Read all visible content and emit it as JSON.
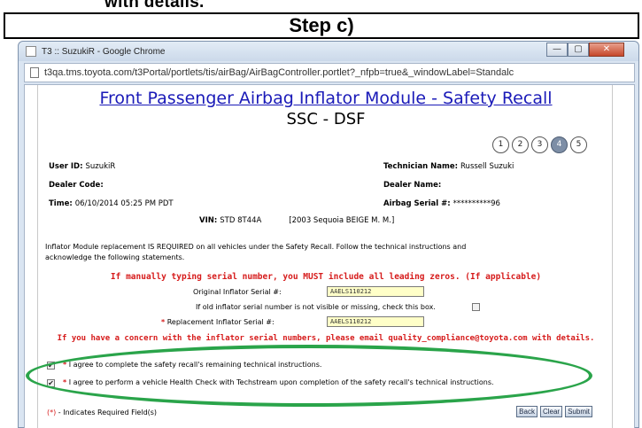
{
  "top_cut_text": "with details.",
  "step_heading": "Step c)",
  "window": {
    "title": "T3 :: SuzukiR - Google Chrome",
    "minimize": "—",
    "maximize": "▢",
    "close": "✕",
    "url": "t3qa.tms.toyota.com/t3Portal/portlets/tis/airBag/AirBagController.portlet?_nfpb=true&_windowLabel=Standalc"
  },
  "page": {
    "title": "Front Passenger Airbag Inflator Module - Safety Recall",
    "subtitle": "SSC - DSF",
    "steps": [
      "1",
      "2",
      "3",
      "4",
      "5"
    ],
    "active_step": "4"
  },
  "fields": {
    "user_id_label": "User ID:",
    "user_id": "SuzukiR",
    "technician_label": "Technician Name:",
    "technician": "Russell Suzuki",
    "dealer_code_label": "Dealer Code:",
    "dealer_name_label": "Dealer Name:",
    "time_label": "Time:",
    "time": "06/10/2014 05:25 PM PDT",
    "airbag_serial_label": "Airbag Serial #:",
    "airbag_serial": "**********96",
    "vin_label": "VIN:",
    "vin": "STD 8T44A",
    "vehicle": "[2003 Sequoia BEIGE M. M.]"
  },
  "instructions": {
    "line1_a": "Inflator Module replacement IS REQUIRED",
    "line1_b": "on all vehicles under the Safety Recall. Follow the technical instructions and",
    "line2": "acknowledge the following statements."
  },
  "serial_note": "If manually typing serial number, you MUST include all leading zeros. (If applicable)",
  "original_serial_label": "Original Inflator Serial #:",
  "original_serial_value": "AAELS110212",
  "missing_label": "If old inflator serial number is not visible or missing, check this box.",
  "replacement_label": "Replacement Inflator Serial #:",
  "replacement_serial_value": "AAELS110212",
  "required_star": "*",
  "contact_note": "If you have a concern with the inflator serial numbers, please email quality_compliance@toyota.com with details.",
  "agree1": "I agree to complete the safety recall's remaining technical instructions.",
  "agree2": "I agree to perform a vehicle Health Check with Techstream upon completion of the safety recall's technical instructions.",
  "required_note": "- Indicates Required Field(s)",
  "required_marker": "(*)",
  "buttons": {
    "back": "Back",
    "clear": "Clear",
    "submit": "Submit"
  },
  "colors": {
    "link_blue": "#1a1ab8",
    "warning_red": "#d61b1b",
    "highlight_oval": "#2aa44a",
    "input_yellow": "#ffffc8"
  }
}
